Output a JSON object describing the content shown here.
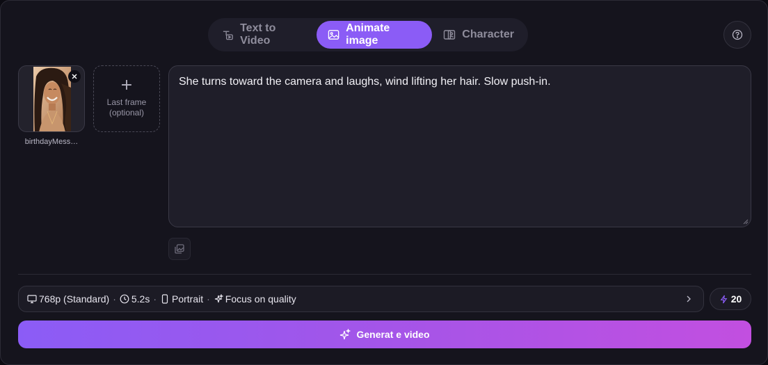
{
  "tabs": [
    {
      "label": "Text to Video",
      "icon": "text-video-icon",
      "active": false
    },
    {
      "label": "Animate image",
      "icon": "animate-image-icon",
      "active": true
    },
    {
      "label": "Character",
      "icon": "character-icon",
      "active": false
    }
  ],
  "frames": {
    "first": {
      "filename": "birthdayMess…"
    },
    "last": {
      "label_line1": "Last frame",
      "label_line2": "(optional)"
    }
  },
  "prompt": {
    "value": "She turns toward the camera and laughs, wind lifting her hair. Slow push-in."
  },
  "settings": {
    "resolution": "768p (Standard)",
    "duration": "5.2s",
    "orientation": "Portrait",
    "mode": "Focus on quality"
  },
  "credits": {
    "value": "20"
  },
  "generate": {
    "label": "Generat e video"
  },
  "colors": {
    "accent": "#8b5cf6",
    "gradient_end": "#c24fe0",
    "background": "#15141d"
  }
}
